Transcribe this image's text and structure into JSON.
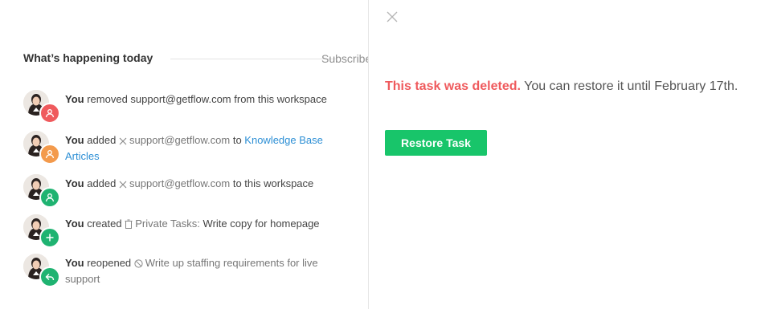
{
  "colors": {
    "deleted_red": "#ef5a5d",
    "link_blue": "#2d8fd5",
    "restore_green": "#18c56a",
    "badge_removed": "#ef5a5d",
    "badge_added_orange": "#f39a4c",
    "badge_added_green": "#1fb371",
    "badge_created": "#1fb371",
    "badge_reopened": "#1fb371"
  },
  "activity": {
    "title": "What’s happening today",
    "subscribe": "Subscribe",
    "items": [
      {
        "badge_icon": "user-remove-icon",
        "actor": "You",
        "verb": "removed",
        "object": "support@getflow.com",
        "tail": "from this workspace"
      },
      {
        "badge_icon": "user-add-icon",
        "actor": "You",
        "verb": "added",
        "object_icon": "x-icon",
        "object": "support@getflow.com",
        "mid": "to",
        "link": "Knowledge Base Articles"
      },
      {
        "badge_icon": "user-add-icon",
        "actor": "You",
        "verb": "added",
        "object_icon": "x-icon",
        "object": "support@getflow.com",
        "tail": "to this workspace"
      },
      {
        "badge_icon": "plus-icon",
        "actor": "You",
        "verb": "created",
        "object_icon": "trash-icon",
        "list": "Private Tasks:",
        "task": "Write copy for homepage"
      },
      {
        "badge_icon": "reply-icon",
        "actor": "You",
        "verb": "reopened",
        "object_icon": "circle-slash-icon",
        "task": "Write up staffing requirements for live support"
      }
    ]
  },
  "panel": {
    "deleted_label": "This task was deleted.",
    "message": "You can restore it until February 17th.",
    "restore_label": "Restore Task"
  }
}
